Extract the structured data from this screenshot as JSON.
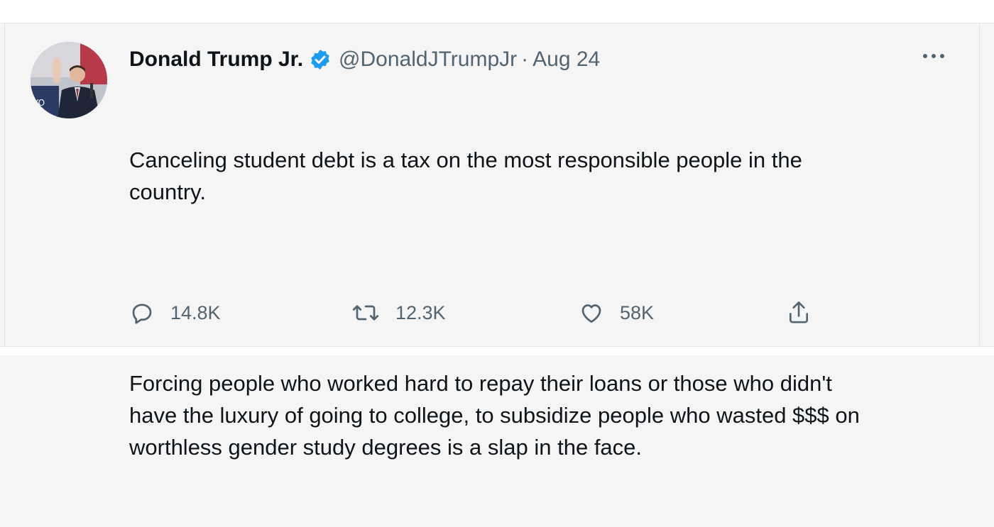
{
  "tweet": {
    "author": {
      "display_name": "Donald Trump Jr.",
      "verified": true,
      "handle": "@DonaldJTrumpJr",
      "separator": "·",
      "date": "Aug 24",
      "avatar_icon": "profile-photo"
    },
    "text": {
      "paragraph_1": "Canceling student debt is a tax on the most responsible people in the\ncountry.",
      "paragraph_2": "Forcing people who worked hard to repay their loans or those who didn't\nhave the luxury of going to college, to subsidize people who wasted $$$ on\nworthless gender study degrees is a slap in the face."
    },
    "actions": {
      "replies": "14.8K",
      "retweets": "12.3K",
      "likes": "58K"
    },
    "icons": {
      "reply": "reply-icon",
      "retweet": "retweet-icon",
      "like": "heart-icon",
      "share": "share-icon",
      "more": "more-icon",
      "verified": "verified-badge-icon"
    }
  },
  "colors": {
    "text": "#0f1419",
    "secondary": "#536471",
    "verified": "#1d9bf0",
    "background": "#f5f5f5"
  }
}
